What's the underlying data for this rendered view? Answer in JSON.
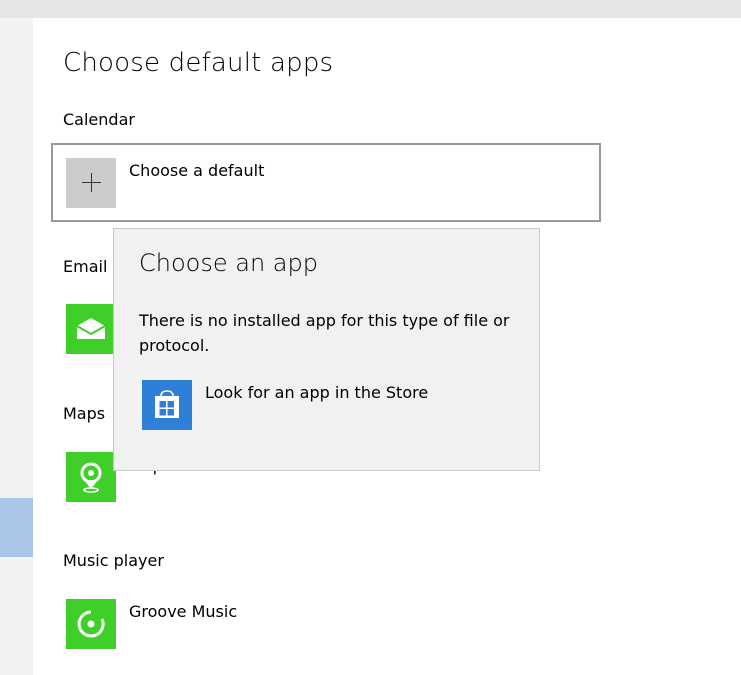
{
  "page": {
    "title": "Choose default apps"
  },
  "sections": {
    "calendar": {
      "label": "Calendar",
      "value": "Choose a default"
    },
    "email": {
      "label": "Email"
    },
    "maps": {
      "label": "Maps",
      "app": "Maps"
    },
    "music": {
      "label": "Music player",
      "app": "Groove Music"
    }
  },
  "flyout": {
    "title": "Choose an app",
    "message": "There is no installed app for this type of file or protocol.",
    "store_link": "Look for an app in the Store"
  },
  "icons": {
    "calendar": "plus-icon",
    "email": "mail-icon",
    "maps": "maps-pin-icon",
    "music": "groove-music-icon",
    "store": "store-bag-icon"
  },
  "colors": {
    "app_tile": "#3fcf29",
    "store_tile": "#2f7ed8",
    "plus_tile": "#cccccc",
    "flyout_bg": "#f1f1f1",
    "nav_selected": "#a9c6e8"
  }
}
